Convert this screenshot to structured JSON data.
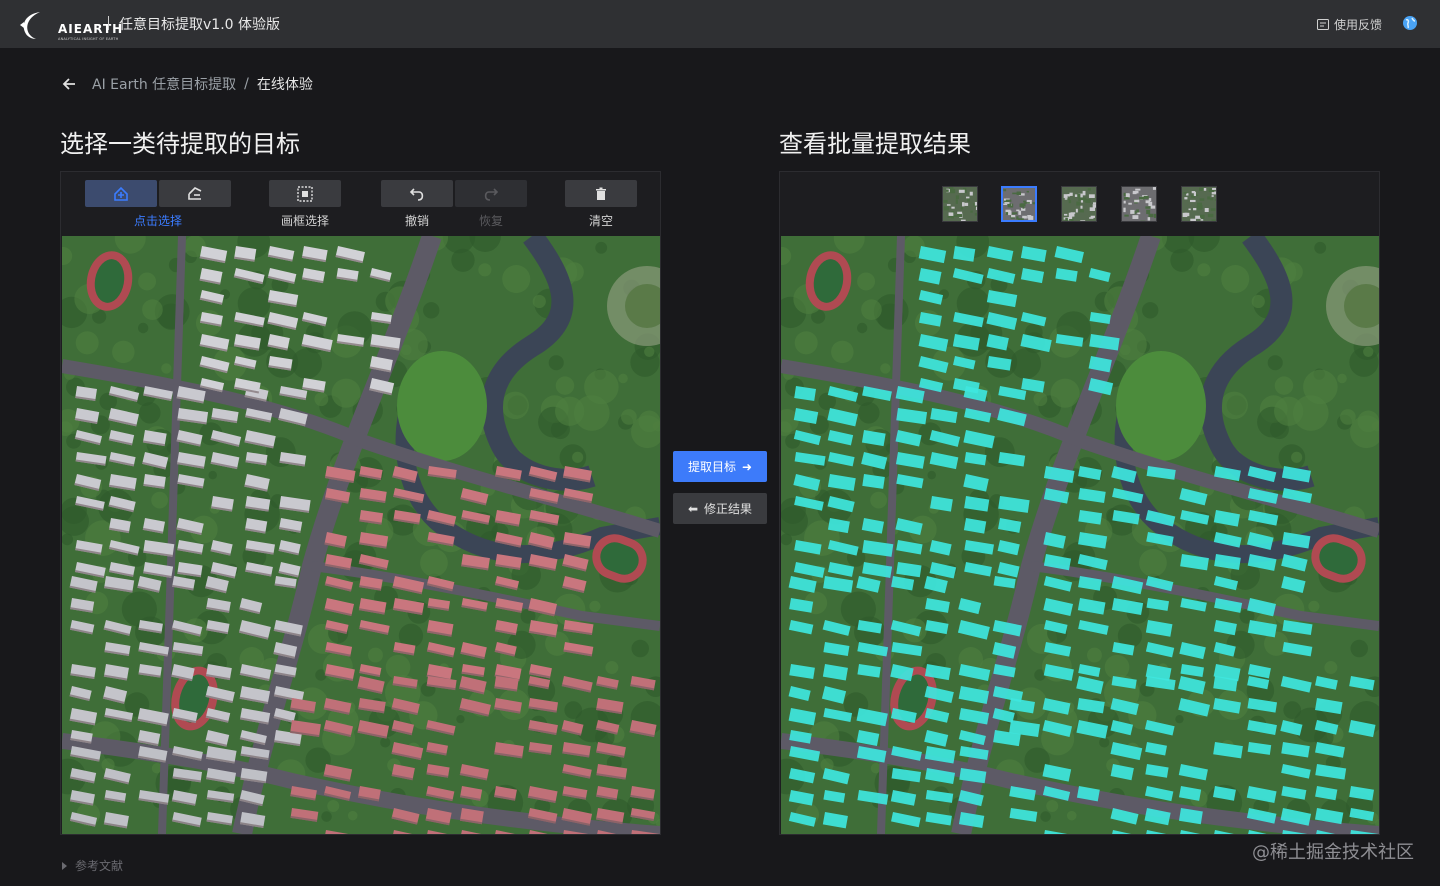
{
  "header": {
    "logo_text": "AIEARTH",
    "logo_sub": "ANALYTICAL INSIGHT OF EARTH",
    "app_title": "任意目标提取v1.0 体验版",
    "feedback_label": "使用反馈"
  },
  "breadcrumb": {
    "link": "AI Earth 任意目标提取",
    "separator": "/",
    "current": "在线体验"
  },
  "left": {
    "title": "选择一类待提取的目标",
    "tools": [
      {
        "label": "点击选择",
        "state": "active"
      },
      {
        "label": "画框选择",
        "state": "normal"
      },
      {
        "label": "撤销",
        "state": "normal"
      },
      {
        "label": "恢复",
        "state": "disabled"
      },
      {
        "label": "清空",
        "state": "normal"
      }
    ]
  },
  "right": {
    "title": "查看批量提取结果",
    "thumbnail_count": 5,
    "active_thumbnail": 2
  },
  "actions": {
    "extract_label": "提取目标",
    "fix_label": "修正结果"
  },
  "footer": {
    "references": "参考文献",
    "watermark": "@稀土掘金技术社区"
  },
  "colors": {
    "accent": "#3d7bfa",
    "highlight": "#3ee6de",
    "background": "#18181b",
    "topbar": "#2f3033"
  }
}
